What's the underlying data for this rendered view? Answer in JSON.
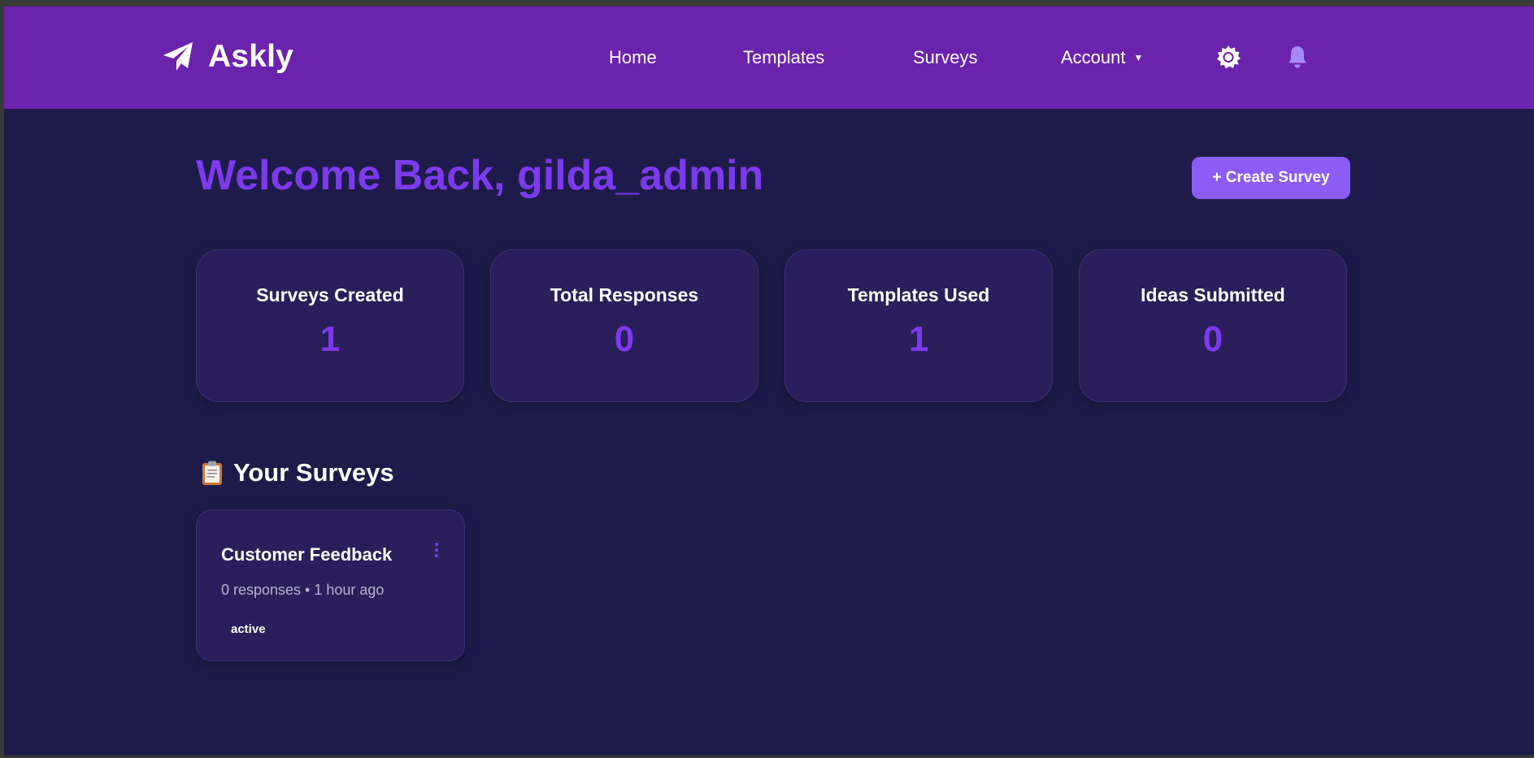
{
  "nav": {
    "brand": "Askly",
    "links": {
      "home": "Home",
      "templates": "Templates",
      "surveys": "Surveys",
      "account": "Account"
    },
    "account_caret": "▼"
  },
  "welcome": {
    "title": "Welcome Back, gilda_admin",
    "create_button": "+ Create Survey"
  },
  "stats": [
    {
      "label": "Surveys Created",
      "value": "1"
    },
    {
      "label": "Total Responses",
      "value": "0"
    },
    {
      "label": "Templates Used",
      "value": "1"
    },
    {
      "label": "Ideas Submitted",
      "value": "0"
    }
  ],
  "surveys_section": {
    "title": "Your Surveys",
    "icon": "clipboard-icon",
    "items": [
      {
        "title": "Customer Feedback",
        "meta": "0 responses • 1 hour ago",
        "status": "active"
      }
    ]
  },
  "icons": {
    "brand": "paper-plane-icon",
    "theme": "gear-icon",
    "notifications": "bell-icon",
    "survey_menu": "kebab-menu-icon"
  },
  "colors": {
    "navbar": "#6b23ad",
    "background": "#1e1b4a",
    "accent": "#7c3aed",
    "button": "#8b5cf6",
    "card": "#2a1f5a"
  }
}
